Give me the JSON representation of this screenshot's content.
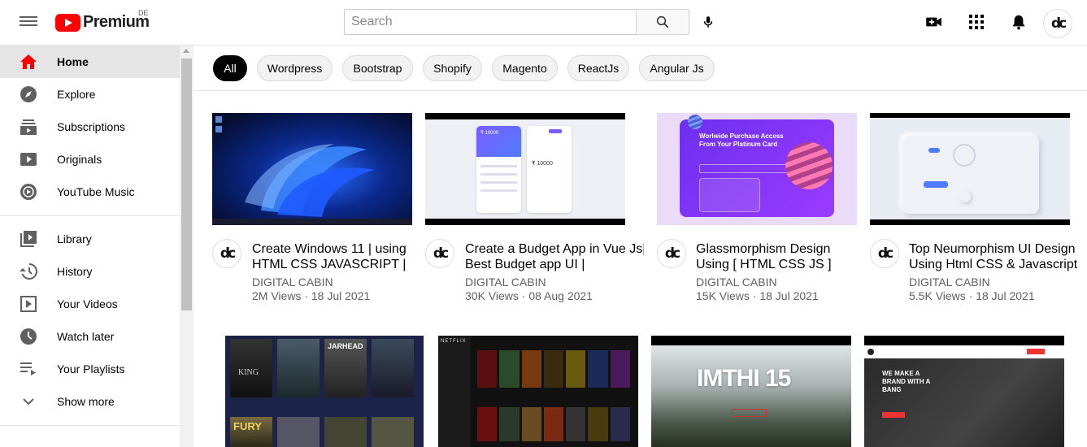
{
  "header": {
    "logo_text": "Premium",
    "country_code": "DE",
    "search_placeholder": "Search"
  },
  "sidebar": {
    "items": [
      {
        "label": "Home",
        "icon": "home-icon",
        "active": true
      },
      {
        "label": "Explore",
        "icon": "compass-icon"
      },
      {
        "label": "Subscriptions",
        "icon": "subscriptions-icon"
      },
      {
        "label": "Originals",
        "icon": "originals-icon"
      },
      {
        "label": "YouTube Music",
        "icon": "music-icon"
      }
    ],
    "library_items": [
      {
        "label": "Library",
        "icon": "library-icon"
      },
      {
        "label": "History",
        "icon": "history-icon"
      },
      {
        "label": "Your Videos",
        "icon": "your-videos-icon"
      },
      {
        "label": "Watch later",
        "icon": "clock-icon"
      },
      {
        "label": "Your Playlists",
        "icon": "playlist-icon"
      },
      {
        "label": "Show more",
        "icon": "chevron-down-icon"
      }
    ]
  },
  "chips": [
    "All",
    "Wordpress",
    "Bootstrap",
    "Shopify",
    "Magento",
    "ReactJs",
    "Angular Js"
  ],
  "videos": [
    {
      "title_line1": "Create Windows 11 | using",
      "title_line2": "HTML CSS JAVASCRIPT |",
      "channel": "DIGITAL CABIN",
      "stats": "2M Views · 18 Jul 2021"
    },
    {
      "title_line1": "Create a Budget App in Vue Js|",
      "title_line2": "Best Budget app UI |",
      "channel": "DIGITAL CABIN",
      "stats": "30K Views · 08 Aug 2021"
    },
    {
      "title_line1": "Glassmorphism Design",
      "title_line2": "Using [ HTML CSS JS ]",
      "channel": "DIGITAL CABIN",
      "stats": "15K Views · 18 Jul 2021"
    },
    {
      "title_line1": "Top Neumorphism UI Design",
      "title_line2": "Using Html CSS & Javascript",
      "channel": "DIGITAL CABIN",
      "stats": "5.5K Views · 18 Jul 2021"
    }
  ],
  "thumb_text": {
    "budget_balance": "₹ 10000",
    "glass_headline1": "Worlwide Purchase Access",
    "glass_headline2": "From Your Platinum Card",
    "imthi": "IMTHI 15",
    "netflix": "NETFLIX",
    "agency_line1": "WE MAKE A",
    "agency_line2": "BRAND WITH A",
    "agency_line3": "BANG",
    "movie_king": "KING",
    "movie_jarhead": "JARHEAD",
    "movie_fury": "FURY"
  },
  "colors": {
    "brand_red": "#ff0000",
    "active_chip": "#030303"
  }
}
